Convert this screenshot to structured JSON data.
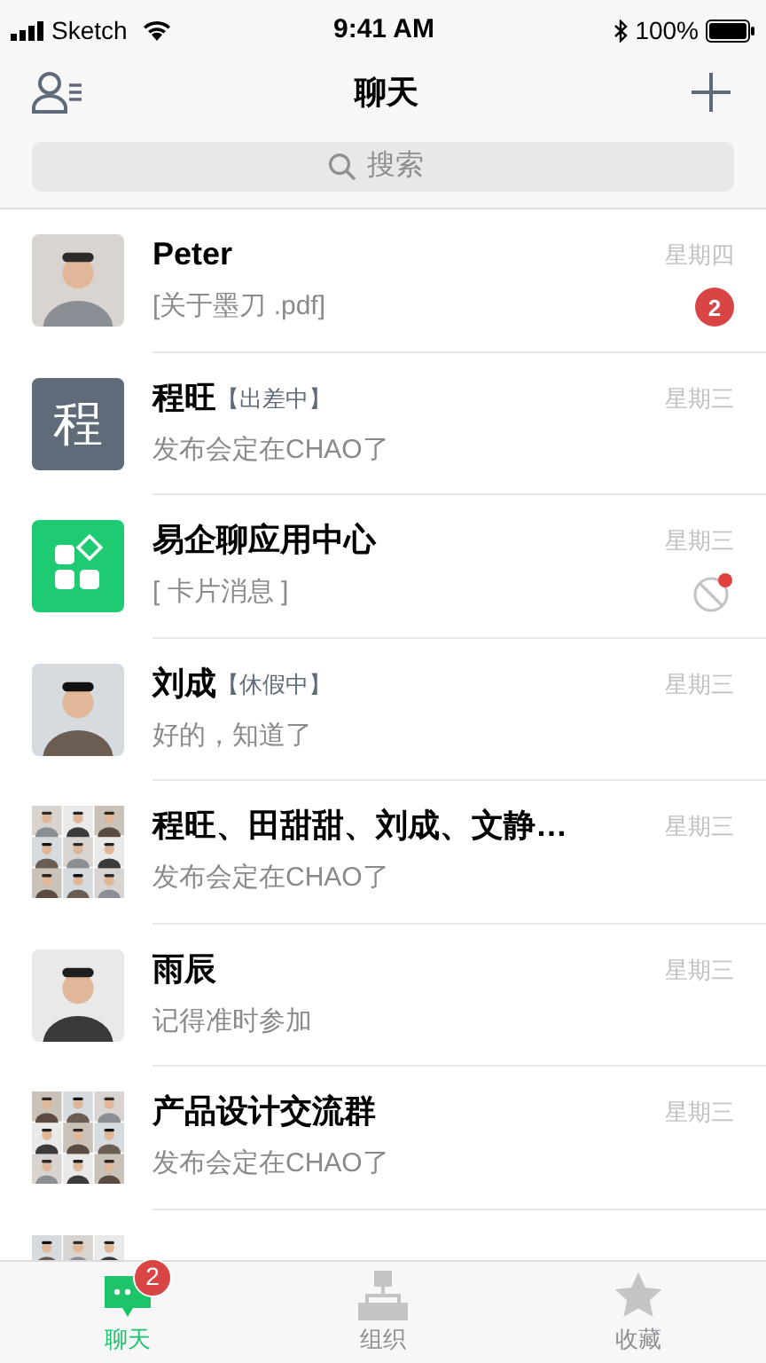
{
  "status_bar": {
    "carrier": "Sketch",
    "time": "9:41 AM",
    "battery": "100%"
  },
  "header": {
    "title": "聊天"
  },
  "search": {
    "placeholder": "搜索"
  },
  "chats": [
    {
      "name": "Peter",
      "preview": "[关于墨刀 .pdf]",
      "time": "星期四",
      "unread": "2",
      "muted": false
    },
    {
      "avatar": {
        "kind": "letter",
        "text": "程"
      },
      "name": "程旺",
      "tag": "【出差中】",
      "preview": "发布会定在CHAO了",
      "time": "星期三",
      "muted": false
    },
    {
      "avatar": {
        "kind": "app"
      },
      "name": "易企聊应用中心",
      "preview": "[ 卡片消息 ]",
      "time": "星期三",
      "muted": true
    },
    {
      "name": "刘成",
      "tag": "【休假中】",
      "preview": "好的，知道了",
      "time": "星期三",
      "muted": false
    },
    {
      "avatar": {
        "kind": "group"
      },
      "name": "程旺、田甜甜、刘成、文静…",
      "preview": "发布会定在CHAO了",
      "time": "星期三",
      "muted": false
    },
    {
      "name": "雨辰",
      "preview": "记得准时参加",
      "time": "星期三",
      "muted": false
    },
    {
      "avatar": {
        "kind": "group"
      },
      "name": "产品设计交流群",
      "preview": "发布会定在CHAO了",
      "time": "星期三",
      "muted": false
    },
    {
      "avatar": {
        "kind": "group"
      },
      "muted": false
    }
  ],
  "tab_bar": [
    {
      "kind": "chat",
      "label": "聊天",
      "selected": true,
      "badge": "2"
    },
    {
      "kind": "org",
      "label": "组织",
      "selected": false
    },
    {
      "kind": "star",
      "label": "收藏",
      "selected": false
    }
  ]
}
